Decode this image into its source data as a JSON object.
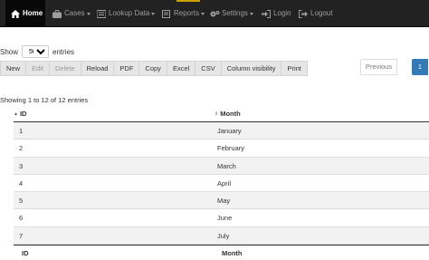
{
  "navbar": {
    "items": [
      {
        "label": "Home",
        "icon": "home-icon",
        "active": true
      },
      {
        "label": "Cases",
        "icon": "briefcase-icon",
        "dropdown": true
      },
      {
        "label": "Lookup Data",
        "icon": "list-icon",
        "dropdown": true
      },
      {
        "label": "Reports",
        "icon": "report-icon",
        "dropdown": true
      },
      {
        "label": "Settings",
        "icon": "gears-icon",
        "dropdown": true
      },
      {
        "label": "Login",
        "icon": "login-icon"
      },
      {
        "label": "Logout",
        "icon": "logout-icon"
      }
    ]
  },
  "length": {
    "prefix": "Show",
    "value": "50",
    "suffix": "entries"
  },
  "buttons": [
    {
      "label": "New",
      "disabled": false
    },
    {
      "label": "Edit",
      "disabled": true
    },
    {
      "label": "Delete",
      "disabled": true
    },
    {
      "label": "Reload",
      "disabled": false
    },
    {
      "label": "PDF",
      "disabled": false
    },
    {
      "label": "Copy",
      "disabled": false
    },
    {
      "label": "Excel",
      "disabled": false
    },
    {
      "label": "CSV",
      "disabled": false
    },
    {
      "label": "Column visibility",
      "disabled": false
    },
    {
      "label": "Print",
      "disabled": false
    }
  ],
  "pagination": {
    "previous": "Previous",
    "current": "1"
  },
  "info": "Showing 1 to 12 of 12 entries",
  "table": {
    "columns": [
      "ID",
      "Month"
    ],
    "rows": [
      [
        "1",
        "January"
      ],
      [
        "2",
        "February"
      ],
      [
        "3",
        "March"
      ],
      [
        "4",
        "April"
      ],
      [
        "5",
        "May"
      ],
      [
        "6",
        "June"
      ],
      [
        "7",
        "July"
      ]
    ],
    "footer": [
      "ID",
      "Month"
    ]
  },
  "colors": {
    "navbar_bg": "#222222",
    "active_bg": "#080808",
    "primary": "#337ab7",
    "stripe": "#f2f2f2"
  }
}
